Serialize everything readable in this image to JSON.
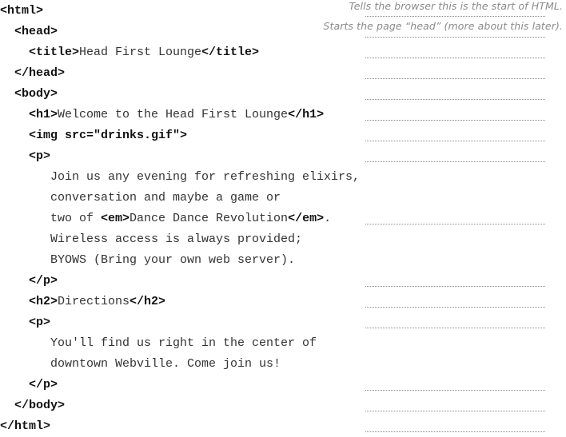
{
  "lines": [
    {
      "indent": 0,
      "parts": [
        {
          "t": "<html>",
          "tag": true
        }
      ]
    },
    {
      "indent": 18,
      "parts": [
        {
          "t": "<head>",
          "tag": true
        }
      ]
    },
    {
      "indent": 36,
      "parts": [
        {
          "t": "<title>",
          "tag": true
        },
        {
          "t": "Head First Lounge",
          "tag": false
        },
        {
          "t": "</title>",
          "tag": true
        }
      ]
    },
    {
      "indent": 18,
      "parts": [
        {
          "t": "</head>",
          "tag": true
        }
      ]
    },
    {
      "indent": 18,
      "parts": [
        {
          "t": "<body>",
          "tag": true
        }
      ]
    },
    {
      "indent": 36,
      "parts": [
        {
          "t": "<h1>",
          "tag": true
        },
        {
          "t": "Welcome to the Head First Lounge",
          "tag": false
        },
        {
          "t": "</h1>",
          "tag": true
        }
      ]
    },
    {
      "indent": 36,
      "parts": [
        {
          "t": "<img src=\"drinks.gif\">",
          "tag": true
        }
      ]
    },
    {
      "indent": 36,
      "parts": [
        {
          "t": "<p>",
          "tag": true
        }
      ]
    },
    {
      "indent": 63,
      "parts": [
        {
          "t": "Join us any evening for refreshing elixirs,",
          "tag": false
        }
      ]
    },
    {
      "indent": 63,
      "parts": [
        {
          "t": "conversation and maybe a game or",
          "tag": false
        }
      ]
    },
    {
      "indent": 63,
      "parts": [
        {
          "t": "two of ",
          "tag": false
        },
        {
          "t": "<em>",
          "tag": true
        },
        {
          "t": "Dance Dance Revolution",
          "tag": false
        },
        {
          "t": "</em>",
          "tag": true
        },
        {
          "t": ".",
          "tag": false
        }
      ]
    },
    {
      "indent": 63,
      "parts": [
        {
          "t": "Wireless access is always provided;",
          "tag": false
        }
      ]
    },
    {
      "indent": 63,
      "parts": [
        {
          "t": "BYOWS (Bring your own web server).",
          "tag": false
        }
      ]
    },
    {
      "indent": 36,
      "parts": [
        {
          "t": "</p>",
          "tag": true
        }
      ]
    },
    {
      "indent": 36,
      "parts": [
        {
          "t": "<h2>",
          "tag": true
        },
        {
          "t": "Directions",
          "tag": false
        },
        {
          "t": "</h2>",
          "tag": true
        }
      ]
    },
    {
      "indent": 36,
      "parts": [
        {
          "t": "<p>",
          "tag": true
        }
      ]
    },
    {
      "indent": 63,
      "parts": [
        {
          "t": "You'll find us right in the center of",
          "tag": false
        }
      ]
    },
    {
      "indent": 63,
      "parts": [
        {
          "t": "downtown Webville. Come join us!",
          "tag": false
        }
      ]
    },
    {
      "indent": 36,
      "parts": [
        {
          "t": "</p>",
          "tag": true
        }
      ]
    },
    {
      "indent": 18,
      "parts": [
        {
          "t": "</body>",
          "tag": true
        }
      ]
    },
    {
      "indent": 0,
      "parts": [
        {
          "t": "</html>",
          "tag": true
        }
      ]
    }
  ],
  "notes": [
    "Tells the browser this is the start of HTML.",
    "Starts the page “head” (more about this later)."
  ],
  "blank_rows": [
    0,
    1,
    2,
    3,
    4,
    5,
    6,
    7,
    10,
    13,
    14,
    15,
    18,
    19,
    20
  ]
}
